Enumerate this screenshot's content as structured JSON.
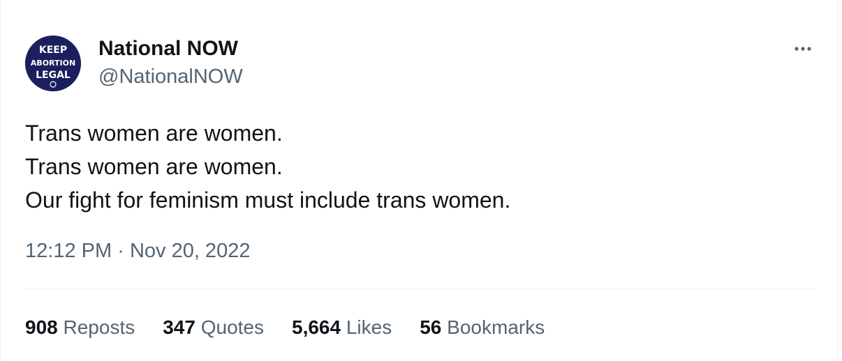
{
  "author": {
    "display_name": "National NOW",
    "handle": "@NationalNOW",
    "avatar_text": [
      "KEEP",
      "ABORTION",
      "LEGAL"
    ],
    "avatar_color": "#1c1f5e"
  },
  "tweet": {
    "lines": [
      "Trans women are women.",
      "Trans women are women.",
      "Our fight for feminism must include trans women."
    ],
    "time": "12:12 PM",
    "separator": "·",
    "date": "Nov 20, 2022"
  },
  "stats": {
    "reposts": {
      "count": "908",
      "label": "Reposts"
    },
    "quotes": {
      "count": "347",
      "label": "Quotes"
    },
    "likes": {
      "count": "5,664",
      "label": "Likes"
    },
    "bookmarks": {
      "count": "56",
      "label": "Bookmarks"
    }
  },
  "menu": {
    "icon": "more-dots-icon"
  },
  "colors": {
    "text_primary": "#0f1419",
    "text_secondary": "#536471",
    "divider": "#eff3f4"
  }
}
